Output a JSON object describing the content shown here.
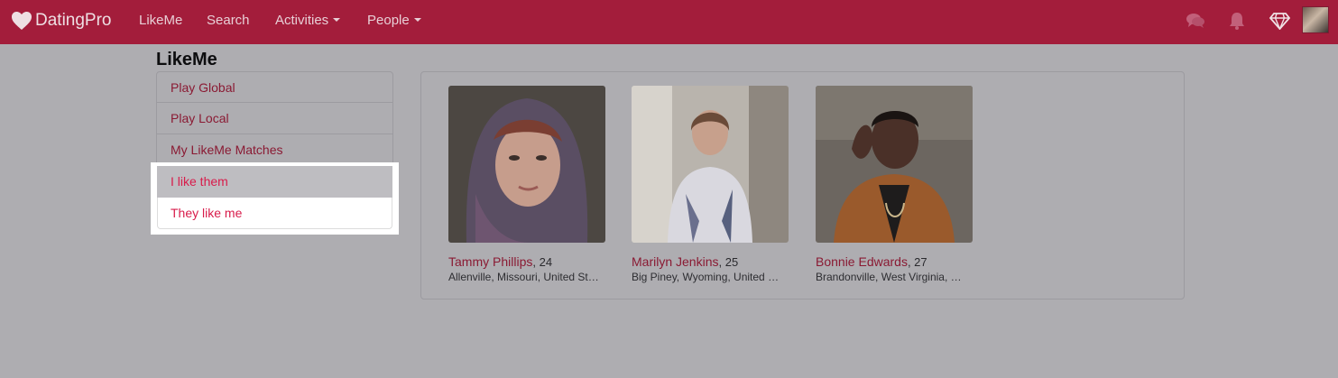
{
  "nav": {
    "brand": "DatingPro",
    "links": [
      "LikeMe",
      "Search",
      "Activities",
      "People"
    ]
  },
  "page": {
    "title": "LikeMe"
  },
  "menu": {
    "items": [
      "Play Global",
      "Play Local",
      "My LikeMe Matches",
      "I like them",
      "They like me"
    ]
  },
  "profiles": [
    {
      "name": "Tammy Phillips",
      "age": ", 24",
      "location": "Allenville, Missouri, United States"
    },
    {
      "name": "Marilyn Jenkins",
      "age": ", 25",
      "location": "Big Piney, Wyoming, United States"
    },
    {
      "name": "Bonnie Edwards",
      "age": ", 27",
      "location": "Brandonville, West Virginia, United States"
    }
  ],
  "colors": {
    "navbar": "#a31d3b",
    "link": "#8a1a33",
    "active_link": "#d81c4b"
  }
}
